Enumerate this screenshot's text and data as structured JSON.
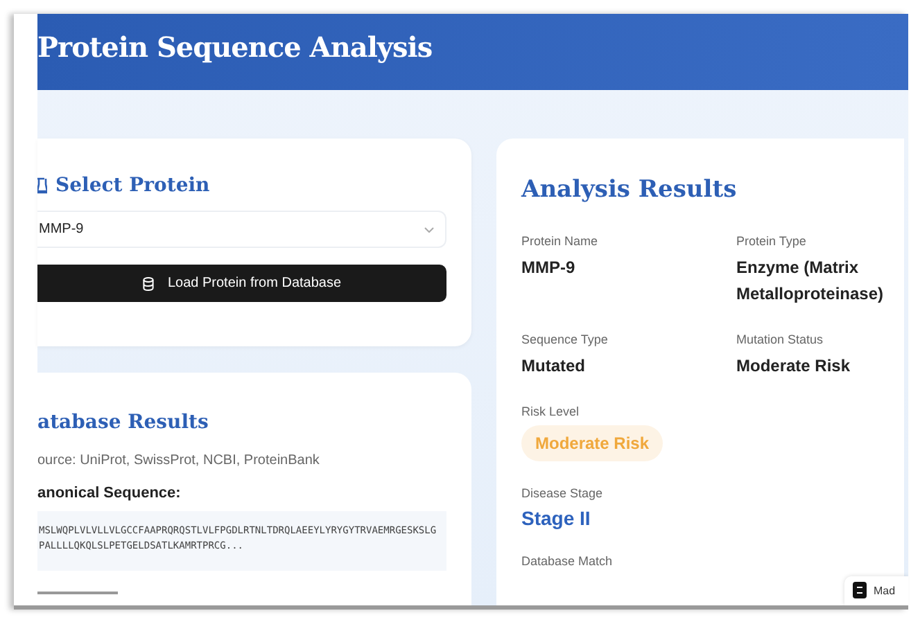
{
  "header": {
    "title": "Protein Sequence Analysis"
  },
  "select_protein": {
    "title": "Select Protein",
    "dropdown": {
      "value": "MMP-9"
    },
    "button": "Load Protein from Database"
  },
  "database_results": {
    "title": "atabase Results",
    "source": "ource: UniProt, SwissProt, NCBI, ProteinBank",
    "sequence_label": "anonical Sequence:",
    "sequence": "MSLWQPLVLVLLVLGCCFAAPRQRQSTLVLFPGDLRTNLTDRQLAEEYLYRYGYTRVAEMRGESKSLGPALLLLQKQLSLPETGELDSATLKAMRTPRCG..."
  },
  "analysis_results": {
    "title": "Analysis Results",
    "fields": [
      {
        "kind": "text",
        "label": "Protein Name",
        "value": "MMP-9"
      },
      {
        "kind": "text",
        "label": "Protein Type",
        "value": "Enzyme (Matrix Metalloproteinase)"
      },
      {
        "kind": "text",
        "label": "Sequence Type",
        "value": "Mutated"
      },
      {
        "kind": "text",
        "label": "Mutation Status",
        "value": "Moderate Risk"
      },
      {
        "kind": "pill",
        "label": "Risk Level",
        "value": "Moderate Risk",
        "color": "#f0a83c"
      },
      {
        "kind": "stage",
        "label": "Disease Stage",
        "value": "Stage II"
      },
      {
        "kind": "text",
        "label": "Database Match"
      }
    ]
  },
  "badge": {
    "text": "Mad"
  }
}
